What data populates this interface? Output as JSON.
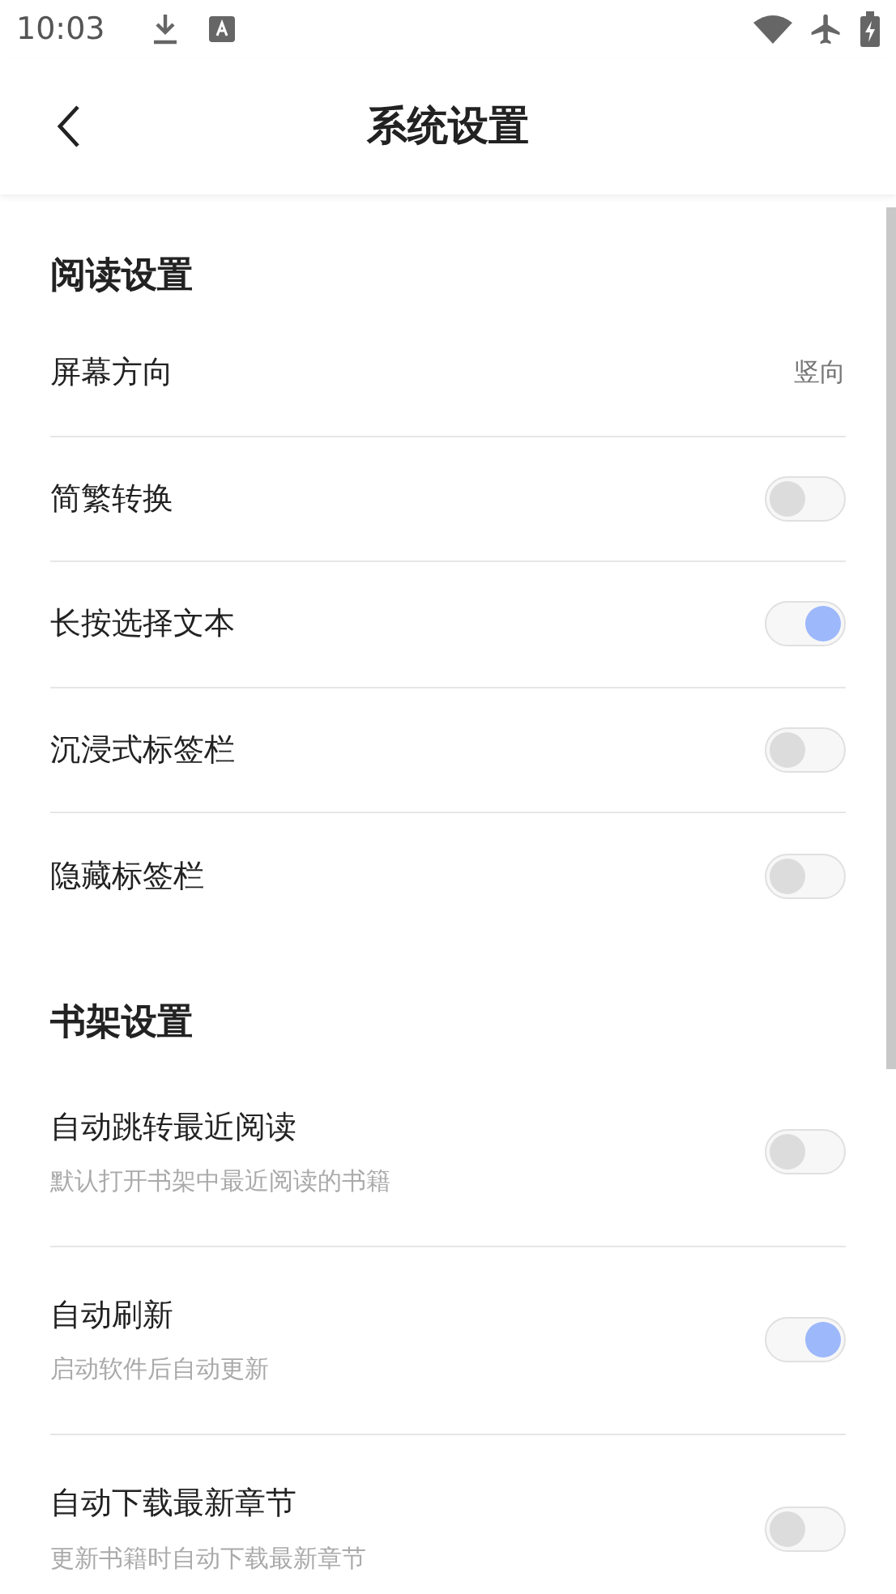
{
  "status_bar": {
    "time": "10:03"
  },
  "header": {
    "title": "系统设置"
  },
  "sections": [
    {
      "title": "阅读设置",
      "rows": [
        {
          "kind": "value",
          "label": "屏幕方向",
          "value": "竖向"
        },
        {
          "kind": "toggle",
          "label": "简繁转换",
          "on": false
        },
        {
          "kind": "toggle",
          "label": "长按选择文本",
          "on": true
        },
        {
          "kind": "toggle",
          "label": "沉浸式标签栏",
          "on": false
        },
        {
          "kind": "toggle",
          "label": "隐藏标签栏",
          "on": false
        }
      ]
    },
    {
      "title": "书架设置",
      "rows": [
        {
          "kind": "toggle",
          "label": "自动跳转最近阅读",
          "subtitle": "默认打开书架中最近阅读的书籍",
          "on": false
        },
        {
          "kind": "toggle",
          "label": "自动刷新",
          "subtitle": "启动软件后自动更新",
          "on": true
        },
        {
          "kind": "toggle",
          "label": "自动下载最新章节",
          "subtitle": "更新书籍时自动下载最新章节",
          "on": false
        }
      ]
    }
  ]
}
